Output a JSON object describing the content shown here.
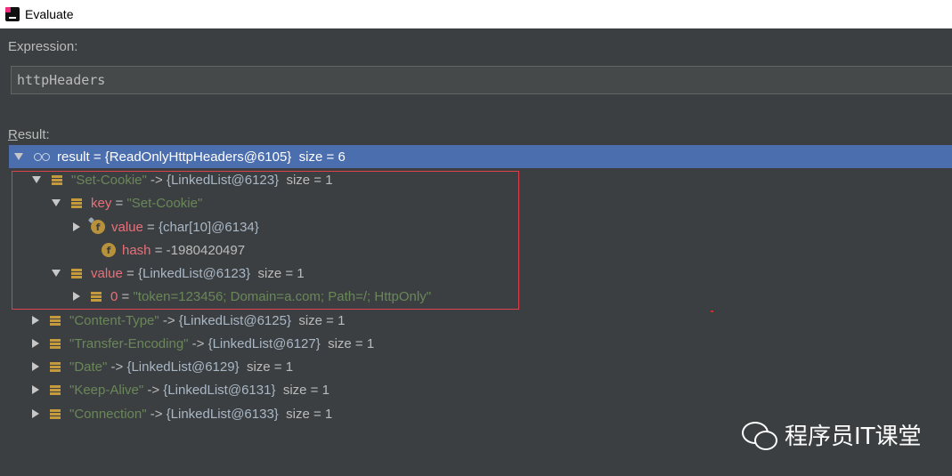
{
  "window": {
    "title": "Evaluate"
  },
  "expression": {
    "label": "Expression:",
    "value": "httpHeaders"
  },
  "result": {
    "label_mnemonic": "R",
    "label_rest": "esult:",
    "root": {
      "name": "result",
      "eq": " = ",
      "ref": "{ReadOnlyHttpHeaders@6105}",
      "size": "size = 6"
    },
    "rows": [
      {
        "name": "\"Set-Cookie\"",
        "arrow": " -> ",
        "ref": "{LinkedList@6123}",
        "size": "size = 1"
      },
      {
        "name": "key",
        "eq": " = ",
        "value": "\"Set-Cookie\""
      },
      {
        "name": "value",
        "eq": " = ",
        "ref": "{char[10]@6134}"
      },
      {
        "name": "hash",
        "eq": " = ",
        "value": "-1980420497"
      },
      {
        "name": "value",
        "eq": " = ",
        "ref": "{LinkedList@6123}",
        "size": "size = 1"
      },
      {
        "name": "0",
        "eq": " = ",
        "value": "\"token=123456; Domain=a.com; Path=/; HttpOnly\""
      },
      {
        "name": "\"Content-Type\"",
        "arrow": " -> ",
        "ref": "{LinkedList@6125}",
        "size": "size = 1"
      },
      {
        "name": "\"Transfer-Encoding\"",
        "arrow": " -> ",
        "ref": "{LinkedList@6127}",
        "size": "size = 1"
      },
      {
        "name": "\"Date\"",
        "arrow": " -> ",
        "ref": "{LinkedList@6129}",
        "size": "size = 1"
      },
      {
        "name": "\"Keep-Alive\"",
        "arrow": " -> ",
        "ref": "{LinkedList@6131}",
        "size": "size = 1"
      },
      {
        "name": "\"Connection\"",
        "arrow": " -> ",
        "ref": "{LinkedList@6133}",
        "size": "size = 1"
      }
    ]
  },
  "field_icon_letter": "f",
  "watermark": {
    "text": "程序员IT课堂"
  },
  "colors": {
    "selection": "#4b6eaf",
    "highlight": "#e0404c",
    "string": "#6a8759",
    "field_name": "#e8707a"
  }
}
